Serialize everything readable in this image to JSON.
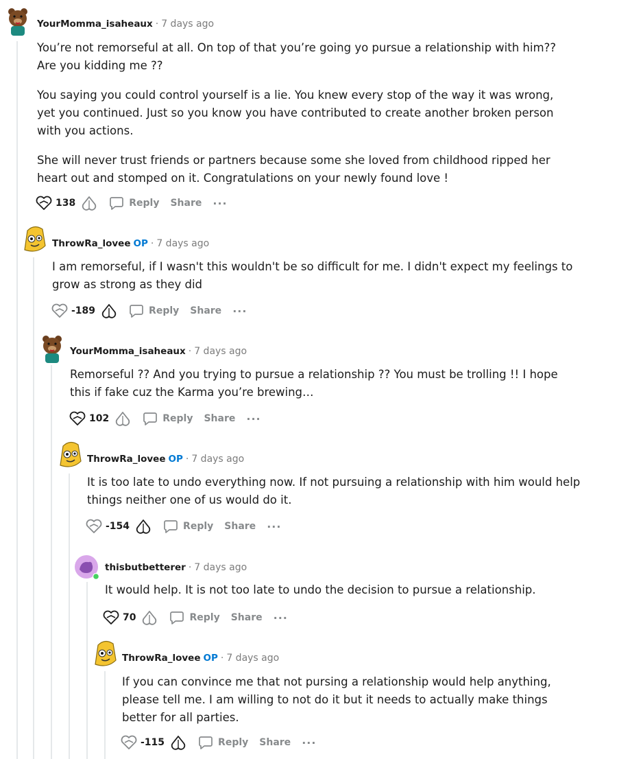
{
  "comments": [
    {
      "author": "YourMomma_isaheaux",
      "op": "",
      "time": "7 days ago",
      "avatar": "bear-avatar",
      "paragraphs": [
        "You’re not remorseful at all. On top of that you’re going yo pursue a relationship with him?? Are you kidding me ??",
        "You saying you could control yourself is a lie. You knew every stop of the way it was wrong, yet you continued. Just so you know you have contributed to create another broken person with you actions.",
        "She will never trust friends or partners because some she loved from childhood ripped her heart out and stomped on it. Congratulations on your newly found love !"
      ],
      "score": "138",
      "reply": "Reply",
      "share": "Share",
      "more": "···"
    },
    {
      "author": "ThrowRa_lovee",
      "op": "OP",
      "time": "7 days ago",
      "avatar": "banana-avatar",
      "paragraphs": [
        "I am remorseful, if I wasn't this wouldn't be so difficult for me. I didn't expect my feelings to grow as strong as they did"
      ],
      "score": "-189",
      "reply": "Reply",
      "share": "Share",
      "more": "···"
    },
    {
      "author": "YourMomma_isaheaux",
      "op": "",
      "time": "7 days ago",
      "avatar": "bear-avatar",
      "paragraphs": [
        "Remorseful ?? And you trying to pursue a relationship ?? You must be trolling !! I hope this if fake cuz the Karma you’re brewing…"
      ],
      "score": "102",
      "reply": "Reply",
      "share": "Share",
      "more": "···"
    },
    {
      "author": "ThrowRa_lovee",
      "op": "OP",
      "time": "7 days ago",
      "avatar": "banana-avatar",
      "paragraphs": [
        "It is too late to undo everything now. If not pursuing a relationship with him would help things neither one of us would do it."
      ],
      "score": "-154",
      "reply": "Reply",
      "share": "Share",
      "more": "···"
    },
    {
      "author": "thisbutbetterer",
      "op": "",
      "time": "7 days ago",
      "avatar": "purple-snoo-avatar",
      "paragraphs": [
        "It would help. It is not too late to undo the decision to pursue a relationship."
      ],
      "score": "70",
      "reply": "Reply",
      "share": "Share",
      "more": "···"
    },
    {
      "author": "ThrowRa_lovee",
      "op": "OP",
      "time": "7 days ago",
      "avatar": "banana-avatar",
      "paragraphs": [
        "If you can convince me that not pursing a relationship would help anything, please tell me. I am willing to not do it but it needs to actually make things better for all parties."
      ],
      "score": "-115",
      "reply": "Reply",
      "share": "Share",
      "more": "···"
    }
  ],
  "colors": {
    "op_badge": "#0079d3",
    "meta_gray": "#7c7c7c",
    "thread_line": "#e5e8ea",
    "online_dot": "#46d160"
  }
}
